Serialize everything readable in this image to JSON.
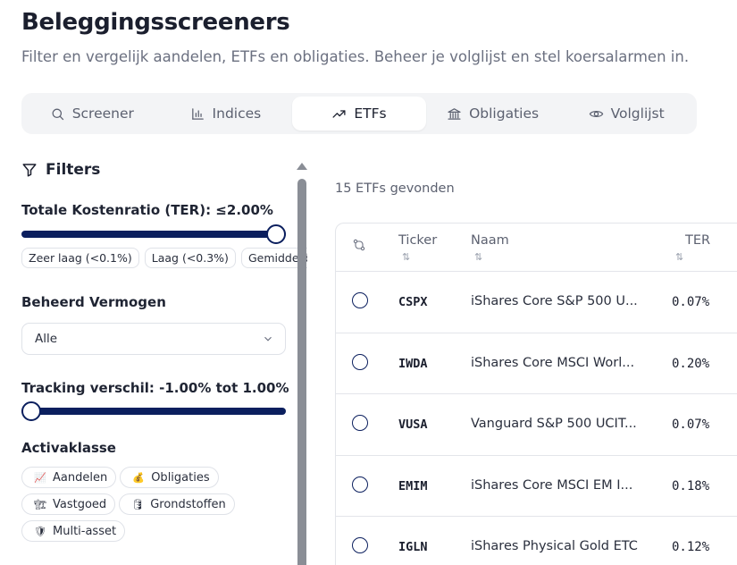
{
  "header": {
    "title": "Beleggingsscreeners",
    "subtitle": "Filter en vergelijk aandelen, ETFs en obligaties. Beheer je volglijst en stel koersalarmen in."
  },
  "tabs": [
    {
      "label": "Screener",
      "icon": "search-icon",
      "active": false
    },
    {
      "label": "Indices",
      "icon": "bar-chart-icon",
      "active": false
    },
    {
      "label": "ETFs",
      "icon": "trending-up-icon",
      "active": true
    },
    {
      "label": "Obligaties",
      "icon": "bank-icon",
      "active": false
    },
    {
      "label": "Volglijst",
      "icon": "eye-icon",
      "active": false
    }
  ],
  "filters": {
    "title": "Filters",
    "ter": {
      "label": "Totale Kostenratio (TER): ≤2.00%",
      "value": 2.0,
      "chips": [
        "Zeer laag (<0.1%)",
        "Laag (<0.3%)",
        "Gemiddeld"
      ]
    },
    "aum": {
      "label": "Beheerd Vermogen",
      "selected": "Alle"
    },
    "tracking": {
      "label": "Tracking verschil: -1.00% tot 1.00%",
      "min": -1.0,
      "max": 1.0
    },
    "asset_class": {
      "label": "Activaklasse",
      "items": [
        {
          "label": "Aandelen",
          "icon": "chart-emoji-icon",
          "glyph": "📈"
        },
        {
          "label": "Obligaties",
          "icon": "money-bag-icon",
          "glyph": "💰"
        },
        {
          "label": "Vastgoed",
          "icon": "construction-icon",
          "glyph": "🏗"
        },
        {
          "label": "Grondstoffen",
          "icon": "barrel-icon",
          "glyph": "🛢"
        },
        {
          "label": "Multi-asset",
          "icon": "shield-icon",
          "glyph": "🛡"
        }
      ]
    }
  },
  "results": {
    "count_text": "15 ETFs gevonden",
    "columns": [
      "Ticker",
      "Naam",
      "TER"
    ],
    "sort_glyph": "⇅",
    "rows": [
      {
        "ticker": "CSPX",
        "name": "iShares Core S&P 500 U...",
        "ter": "0.07%"
      },
      {
        "ticker": "IWDA",
        "name": "iShares Core MSCI Worl...",
        "ter": "0.20%"
      },
      {
        "ticker": "VUSA",
        "name": "Vanguard S&P 500 UCIT...",
        "ter": "0.07%"
      },
      {
        "ticker": "EMIM",
        "name": "iShares Core MSCI EM I...",
        "ter": "0.18%"
      },
      {
        "ticker": "IGLN",
        "name": "iShares Physical Gold ETC",
        "ter": "0.12%"
      }
    ]
  },
  "colors": {
    "accent": "#0b1f5e",
    "tab_bg": "#f3f4f6",
    "border": "#e3e5ea"
  }
}
